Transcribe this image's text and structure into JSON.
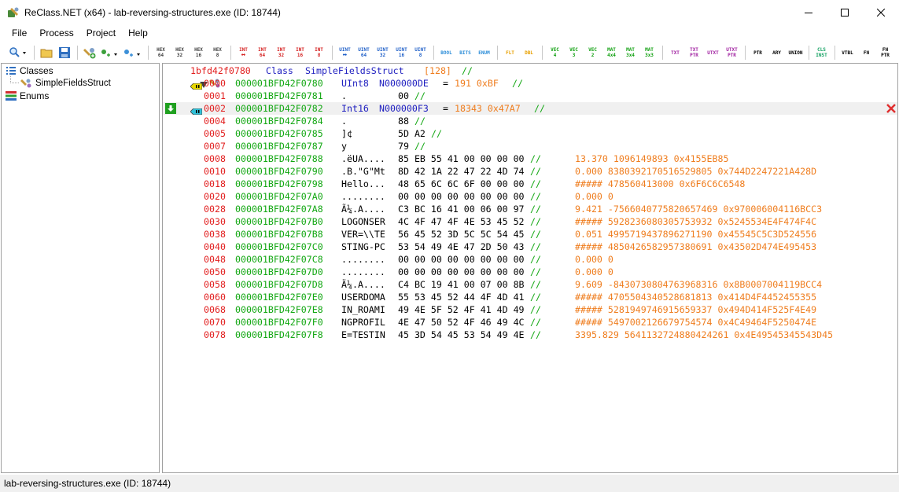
{
  "window": {
    "title": "ReClass.NET (x64) - lab-reversing-structures.exe (ID: 18744)",
    "app_icon": "reclass-app-icon"
  },
  "menu": [
    "File",
    "Process",
    "Project",
    "Help"
  ],
  "toolbar": {
    "icons": [
      "search-dropdown-icon",
      "open-folder-icon",
      "save-icon",
      "add-class-icon",
      "add-bytes-dropdown-icon",
      "insert-bytes-dropdown-icon"
    ],
    "type_groups": [
      [
        [
          "HEX",
          "64"
        ],
        [
          "HEX",
          "32"
        ],
        [
          "HEX",
          "16"
        ],
        [
          "HEX",
          "8"
        ]
      ],
      [
        [
          "INT",
          "↔"
        ],
        [
          "INT",
          "64"
        ],
        [
          "INT",
          "32"
        ],
        [
          "INT",
          "16"
        ],
        [
          "INT",
          "8"
        ]
      ],
      [
        [
          "UINT",
          "↔"
        ],
        [
          "UINT",
          "64"
        ],
        [
          "UINT",
          "32"
        ],
        [
          "UINT",
          "16"
        ],
        [
          "UINT",
          "8"
        ]
      ],
      [
        [
          "BOOL",
          ""
        ],
        [
          "BITS",
          ""
        ],
        [
          "ENUM",
          ""
        ]
      ],
      [
        [
          "FLT",
          ""
        ],
        [
          "DBL",
          ""
        ]
      ],
      [
        [
          "VEC",
          "4"
        ],
        [
          "VEC",
          "3"
        ],
        [
          "VEC",
          "2"
        ],
        [
          "MAT",
          "4x4"
        ],
        [
          "MAT",
          "3x4"
        ],
        [
          "MAT",
          "3x3"
        ]
      ],
      [
        [
          "TXT",
          ""
        ],
        [
          "TXT",
          "PTR"
        ],
        [
          "UTXT",
          ""
        ],
        [
          "UTXT",
          "PTR"
        ]
      ],
      [
        [
          "PTR",
          ""
        ],
        [
          "ARY",
          ""
        ],
        [
          "UNION",
          ""
        ]
      ],
      [
        [
          "CLS",
          "INST"
        ]
      ],
      [
        [
          "VTBL",
          ""
        ],
        [
          "FN",
          ""
        ],
        [
          "FN",
          "PTR"
        ]
      ]
    ],
    "type_colors": [
      "#404040",
      "#d42020",
      "#2060c8",
      "#2a8cd8",
      "#e8a000",
      "#10a010",
      "#a020a0",
      "#000000",
      "#10a060",
      "#000000"
    ]
  },
  "tree": {
    "classes_label": "Classes",
    "class_item": "SimpleFieldsStruct",
    "enums_label": "Enums"
  },
  "memory_view": {
    "header": {
      "address": "1bfd42f0780",
      "keyword": "Class",
      "name": "SimpleFieldsStruct",
      "size": "[128]",
      "comment": "//"
    },
    "rows": [
      {
        "off": "0000",
        "addr": "000001BFD42F0780",
        "type": "UInt8",
        "name": "N000000DE",
        "eq": "=",
        "val": "191 0xBF",
        "cmt": "//",
        "marker": "uint-field-marker-icon"
      },
      {
        "off": "0001",
        "addr": "000001BFD42F0781",
        "text": ".",
        "hex": "00",
        "cmt": "//"
      },
      {
        "off": "0002",
        "addr": "000001BFD42F0782",
        "type": "Int16",
        "name": "N000000F3",
        "eq": "=",
        "val": "18343 0x47A7",
        "cmt": "//",
        "marker": "int-field-marker-icon",
        "selected": true
      },
      {
        "off": "0004",
        "addr": "000001BFD42F0784",
        "text": ".",
        "hex": "88",
        "cmt": "//"
      },
      {
        "off": "0005",
        "addr": "000001BFD42F0785",
        "text": "]¢",
        "hex": "5D A2",
        "cmt": "//"
      },
      {
        "off": "0007",
        "addr": "000001BFD42F0787",
        "text": "y",
        "hex": "79",
        "cmt": "//"
      },
      {
        "off": "0008",
        "addr": "000001BFD42F0788",
        "text": ".ëUA....",
        "hex": "85 EB 55 41 00 00 00 00",
        "cmt": "//",
        "val": "13.370 1096149893 0x4155EB85"
      },
      {
        "off": "0010",
        "addr": "000001BFD42F0790",
        "text": ".B.\"G\"Mt",
        "hex": "8D 42 1A 22 47 22 4D 74",
        "cmt": "//",
        "val": "0.000 8380392170516529805 0x744D2247221A428D"
      },
      {
        "off": "0018",
        "addr": "000001BFD42F0798",
        "text": "Hello...",
        "hex": "48 65 6C 6C 6F 00 00 00",
        "cmt": "//",
        "val": "##### 478560413000 0x6F6C6C6548"
      },
      {
        "off": "0020",
        "addr": "000001BFD42F07A0",
        "text": "........",
        "hex": "00 00 00 00 00 00 00 00",
        "cmt": "//",
        "val": "0.000 0"
      },
      {
        "off": "0028",
        "addr": "000001BFD42F07A8",
        "text": "Ã¼.A....",
        "hex": "C3 BC 16 41 00 06 00 97",
        "cmt": "//",
        "val": "9.421 -7566040775820657469 0x970006004116BCC3"
      },
      {
        "off": "0030",
        "addr": "000001BFD42F07B0",
        "text": "LOGONSER",
        "hex": "4C 4F 47 4F 4E 53 45 52",
        "cmt": "//",
        "val": "##### 5928236080305753932 0x5245534E4F474F4C"
      },
      {
        "off": "0038",
        "addr": "000001BFD42F07B8",
        "text": "VER=\\\\TE",
        "hex": "56 45 52 3D 5C 5C 54 45",
        "cmt": "//",
        "val": "0.051 4995719437896271190 0x45545C5C3D524556"
      },
      {
        "off": "0040",
        "addr": "000001BFD42F07C0",
        "text": "STING-PC",
        "hex": "53 54 49 4E 47 2D 50 43",
        "cmt": "//",
        "val": "##### 4850426582957380691 0x43502D474E495453"
      },
      {
        "off": "0048",
        "addr": "000001BFD42F07C8",
        "text": "........",
        "hex": "00 00 00 00 00 00 00 00",
        "cmt": "//",
        "val": "0.000 0"
      },
      {
        "off": "0050",
        "addr": "000001BFD42F07D0",
        "text": "........",
        "hex": "00 00 00 00 00 00 00 00",
        "cmt": "//",
        "val": "0.000 0"
      },
      {
        "off": "0058",
        "addr": "000001BFD42F07D8",
        "text": "Ä¼.A....",
        "hex": "C4 BC 19 41 00 07 00 8B",
        "cmt": "//",
        "val": "9.609 -8430730804763968316 0x8B0007004119BCC4"
      },
      {
        "off": "0060",
        "addr": "000001BFD42F07E0",
        "text": "USERDOMA",
        "hex": "55 53 45 52 44 4F 4D 41",
        "cmt": "//",
        "val": "##### 4705504340528681813 0x414D4F4452455355"
      },
      {
        "off": "0068",
        "addr": "000001BFD42F07E8",
        "text": "IN_ROAMI",
        "hex": "49 4E 5F 52 4F 41 4D 49",
        "cmt": "//",
        "val": "##### 5281949746915659337 0x494D414F525F4E49"
      },
      {
        "off": "0070",
        "addr": "000001BFD42F07F0",
        "text": "NGPROFIL",
        "hex": "4E 47 50 52 4F 46 49 4C",
        "cmt": "//",
        "val": "##### 5497002126679754574 0x4C49464F5250474E"
      },
      {
        "off": "0078",
        "addr": "000001BFD42F07F8",
        "text": "E=TESTIN",
        "hex": "45 3D 54 45 53 54 49 4E",
        "cmt": "//",
        "val": "3395.829 5641132724880424261 0x4E49545345543D45"
      }
    ]
  },
  "statusbar": {
    "text": "lab-reversing-structures.exe (ID: 18744)"
  }
}
